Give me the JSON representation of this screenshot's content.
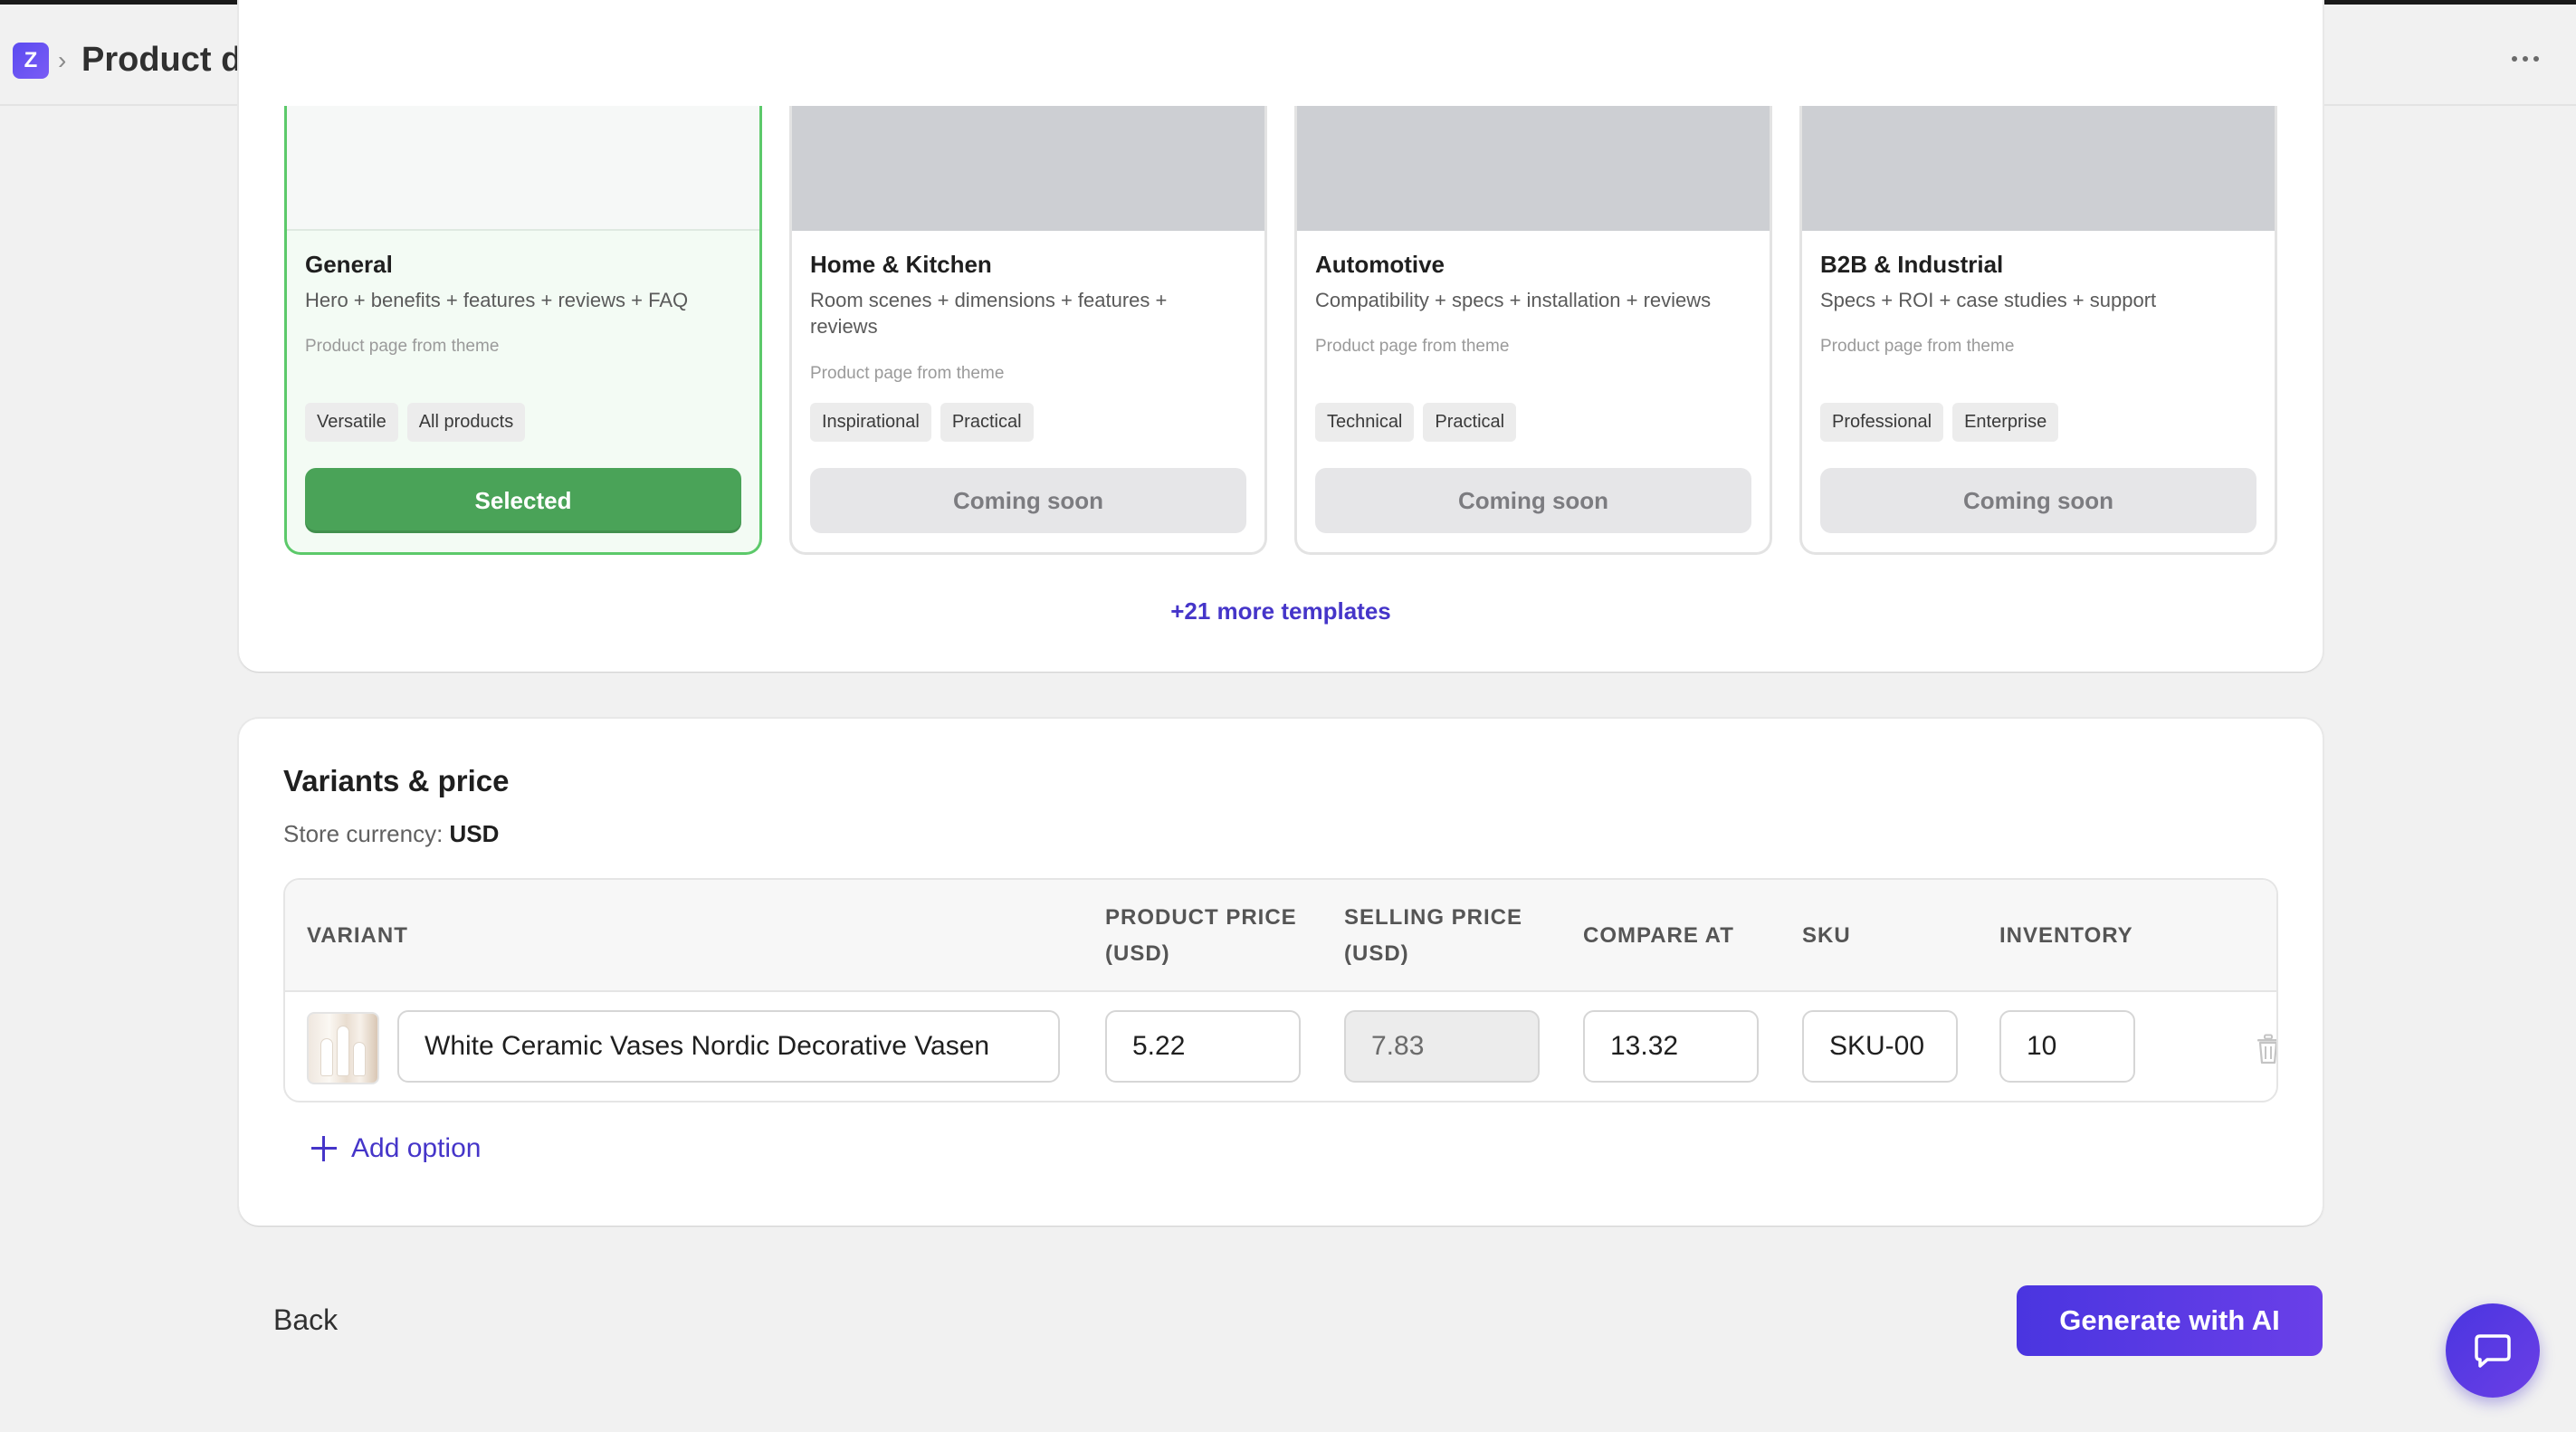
{
  "header": {
    "logo_letter": "Z",
    "separator": "›",
    "title": "Product details"
  },
  "templates": {
    "items": [
      {
        "name": "General",
        "description": "Hero + benefits + features + reviews + FAQ",
        "source": "Product page from theme",
        "tags": [
          "Versatile",
          "All products"
        ],
        "button": "Selected",
        "selected": true
      },
      {
        "name": "Home & Kitchen",
        "description": "Room scenes + dimensions + features + reviews",
        "source": "Product page from theme",
        "tags": [
          "Inspirational",
          "Practical"
        ],
        "button": "Coming soon",
        "selected": false
      },
      {
        "name": "Automotive",
        "description": "Compatibility + specs + installation + reviews",
        "source": "Product page from theme",
        "tags": [
          "Technical",
          "Practical"
        ],
        "button": "Coming soon",
        "selected": false
      },
      {
        "name": "B2B & Industrial",
        "description": "Specs + ROI + case studies + support",
        "source": "Product page from theme",
        "tags": [
          "Professional",
          "Enterprise"
        ],
        "button": "Coming soon",
        "selected": false
      }
    ],
    "more_link": "+21 more templates"
  },
  "variants": {
    "title": "Variants & price",
    "currency_label": "Store currency:",
    "currency_value": "USD",
    "columns": {
      "variant": "VARIANT",
      "product_price_1": "PRODUCT PRICE",
      "product_price_2": "(USD)",
      "selling_price_1": "SELLING PRICE",
      "selling_price_2": "(USD)",
      "compare_at": "COMPARE AT",
      "sku": "SKU",
      "inventory": "INVENTORY"
    },
    "row": {
      "name": "White Ceramic Vases Nordic Decorative Vasen",
      "product_price": "5.22",
      "selling_price": "7.83",
      "compare_at": "13.32",
      "sku": "SKU-00",
      "inventory": "10"
    },
    "add_option": "Add option"
  },
  "footer": {
    "back": "Back",
    "generate": "Generate with AI"
  },
  "colors": {
    "accent": "#4535c9",
    "selected_green": "#4aa358",
    "selected_border": "#5cc96a"
  }
}
